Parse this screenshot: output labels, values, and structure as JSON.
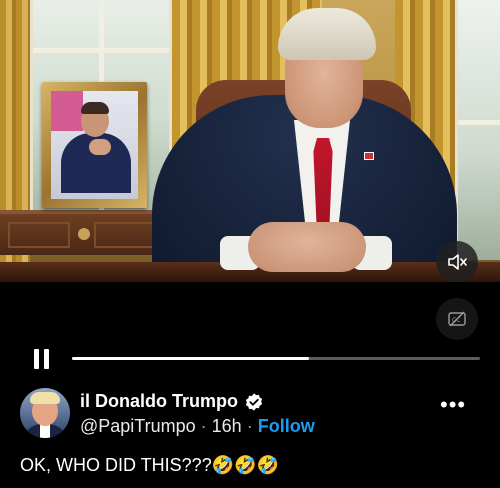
{
  "video": {
    "progress_fraction": 0.58,
    "volume_icon": "speaker-muted-icon",
    "captions_icon": "captions-off-icon",
    "pause_icon": "pause-icon"
  },
  "tweet": {
    "display_name": "il Donaldo Trumpo",
    "verified_icon": "verified-badge-icon",
    "handle": "@PapiTrumpo",
    "separator": "·",
    "time": "16h",
    "follow_label": "Follow",
    "more_label": "•••",
    "text": "OK, WHO DID THIS???",
    "emoji": "🤣🤣🤣"
  },
  "colors": {
    "accent": "#1d9bf0",
    "background": "#000000",
    "progress_track": "#5c5c5c"
  }
}
